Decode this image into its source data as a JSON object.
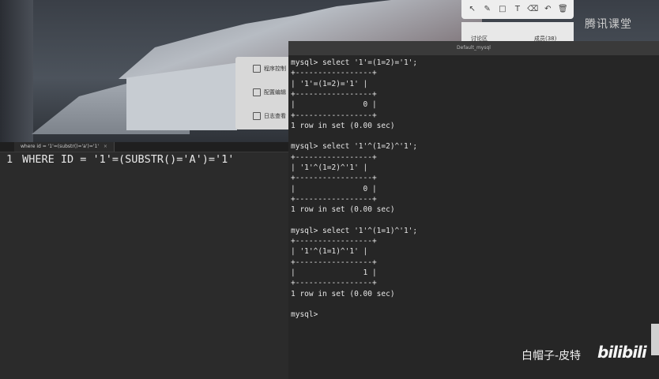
{
  "editor": {
    "tab_label": "where id = '1'=(substr()='a')='1'",
    "tab_close": "×",
    "line_number": "1",
    "code": "WHERE ID = '1'=(SUBSTR()='A')='1'"
  },
  "side_panel": {
    "items": [
      {
        "label": "程序控制"
      },
      {
        "label": "配置编辑"
      },
      {
        "label": "日志查看"
      }
    ]
  },
  "terminal": {
    "title": "Default_mysql",
    "lines": [
      "mysql> select '1'=(1=2)='1';",
      "+-----------------+",
      "| '1'=(1=2)='1' |",
      "+-----------------+",
      "|               0 |",
      "+-----------------+",
      "1 row in set (0.00 sec)",
      "",
      "mysql> select '1'^(1=2)^'1';",
      "+-----------------+",
      "| '1'^(1=2)^'1' |",
      "+-----------------+",
      "|               0 |",
      "+-----------------+",
      "1 row in set (0.00 sec)",
      "",
      "mysql> select '1'^(1=1)^'1';",
      "+-----------------+",
      "| '1'^(1=1)^'1' |",
      "+-----------------+",
      "|               1 |",
      "+-----------------+",
      "1 row in set (0.00 sec)",
      "",
      "mysql>"
    ]
  },
  "toolbar": {
    "tools": [
      "select-tool-icon",
      "pen-icon",
      "rectangle-icon",
      "text-icon",
      "eraser-icon",
      "undo-icon",
      "delete-icon"
    ],
    "glyphs": [
      "↖",
      "✎",
      "□",
      "T",
      "⌫",
      "↶",
      "🗑"
    ]
  },
  "chat": {
    "tab_discussion": "讨论区",
    "tab_members": "成员(38)"
  },
  "branding": {
    "tencent": "腾讯课堂",
    "uploader": "白帽子-皮特",
    "bilibili": "bilibili"
  }
}
